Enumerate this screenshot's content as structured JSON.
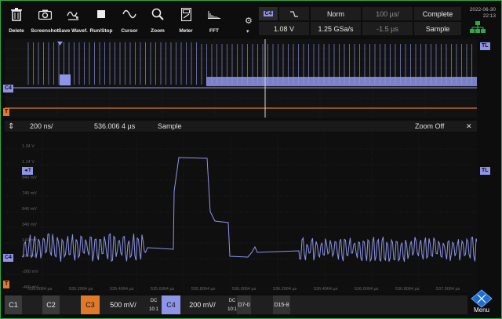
{
  "toolbar": {
    "items": [
      {
        "label": "Delete",
        "icon": "trash-icon"
      },
      {
        "label": "Screenshot",
        "icon": "camera-icon"
      },
      {
        "label": "Save Wavef.",
        "icon": "save-waveform-icon"
      },
      {
        "label": "Run/Stop",
        "icon": "stop-square-icon"
      },
      {
        "label": "Cursor",
        "icon": "cursor-wave-icon"
      },
      {
        "label": "Zoom",
        "icon": "magnifier-icon"
      },
      {
        "label": "Meter",
        "icon": "meter-icon"
      },
      {
        "label": "FFT",
        "icon": "fft-spectrum-icon"
      }
    ]
  },
  "status": {
    "channel": "C4",
    "edge_icon": "falling-edge-icon",
    "trigger_level": "1.08 V",
    "acq_mode": "Norm",
    "sample_rate": "1.25 GSa/s",
    "time_scale": "100 µs/",
    "time_offset": "-1.5 µs",
    "state": "Complete",
    "acq_type": "Sample"
  },
  "datetime": {
    "date": "2022-06-30",
    "time": "22:13"
  },
  "zoombar": {
    "time_div": "200 ns/",
    "position": "536.006 4 µs",
    "mode": "Sample",
    "zoom_off": "Zoom Off",
    "close": "✕",
    "updown": "⇕"
  },
  "markers": {
    "c4": "C4",
    "tl": "TL",
    "t": "T"
  },
  "detail_labels": {
    "y_ticks": [
      "1.34 V",
      "1.14 V",
      "940 mV",
      "740 mV",
      "540 mV",
      "340 mV",
      "140 mV",
      "-60 mV",
      "-260 mV",
      "-460 mV"
    ],
    "x_ticks": [
      "535.0064 µs",
      "535.2064 µs",
      "535.4064 µs",
      "535.6064 µs",
      "535.8064 µs",
      "536.0064 µs",
      "536.2064 µs",
      "536.4064 µs",
      "536.6064 µs",
      "536.8064 µs",
      "537.0064 µs"
    ]
  },
  "bottom": {
    "c1": "C1",
    "c2": "C2",
    "c3": "C3",
    "c3_scale": "500 mV/",
    "c3_coupling": "DC",
    "c3_probe": "10:1",
    "c4": "C4",
    "c4_scale": "200 mV/",
    "c4_coupling": "DC",
    "c4_probe": "10:1",
    "d0_7": "D7-0",
    "d8_15": "D15-8",
    "menu": "Menu"
  },
  "colors": {
    "c4": "#8e95e8",
    "c3": "#e07a2a",
    "frame": "#2fa84a",
    "trigger_line": "#d8d8d8"
  }
}
